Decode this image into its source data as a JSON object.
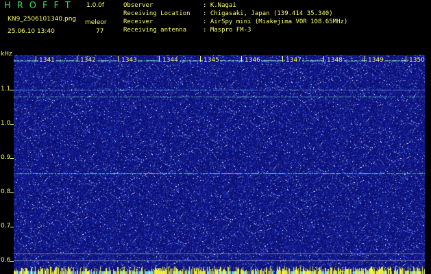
{
  "header": {
    "brand": "HROFFT",
    "version": "1.0.0f",
    "filename": "KN9_2506101340.png",
    "meteor_label": "meleor",
    "meteor_count": "77",
    "datetime": "25.06.10 13:40"
  },
  "info": {
    "observer_key": "Observer",
    "observer_val": ": K.Nagai",
    "location_key": "Receiving Location",
    "location_val": ": Chigasaki, Japan (139.414 35.340)",
    "receiver_key": "Receiver",
    "receiver_val": ": AirSpy mini (Miakejima VOR 108.65MHz)",
    "antenna_key": "Receiving antenna",
    "antenna_val": ": Maspro FM-3"
  },
  "axis": {
    "unit": "kHz",
    "y_labels": [
      "1.1",
      "1.0",
      "0.9",
      "0.8",
      "0.7",
      "0.6"
    ],
    "x_labels": [
      "1341",
      "1342",
      "1343",
      "1344",
      "1345",
      "1346",
      "1347",
      "1348",
      "1349",
      "1350"
    ]
  },
  "colors": {
    "background": "#10168a",
    "text": "#ffff66",
    "brand": "#33dd55",
    "trace": "#7fe8c8"
  }
}
